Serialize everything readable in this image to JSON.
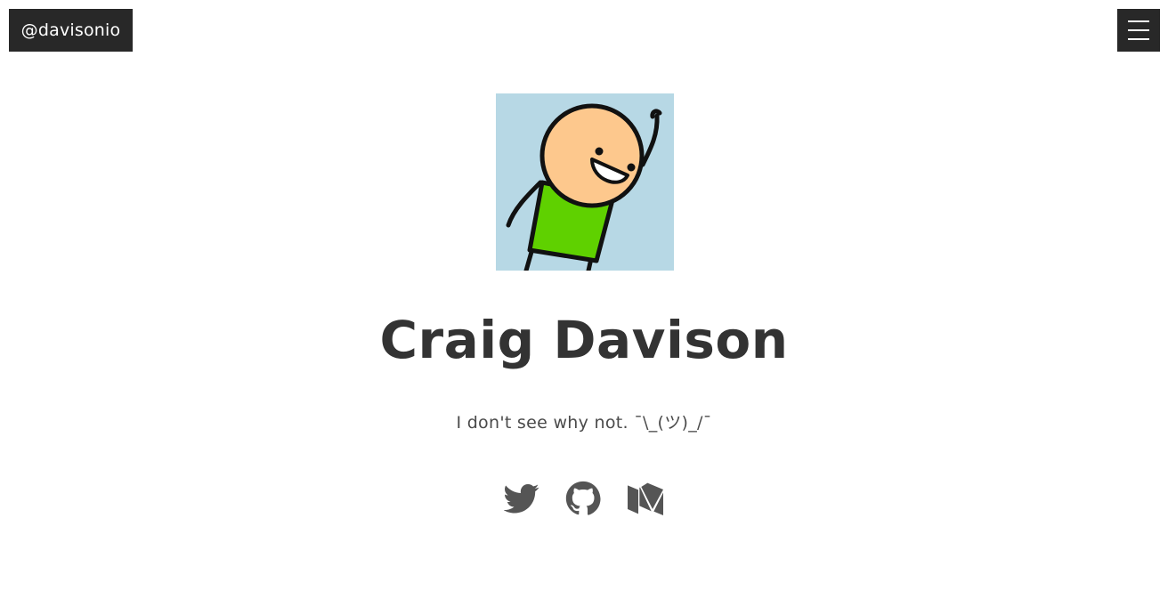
{
  "header": {
    "brand": "@davisonio",
    "menu_icon": "hamburger-menu-icon"
  },
  "profile": {
    "avatar_icon": "cartoon-avatar",
    "name": "Craig Davison",
    "tagline": "I don't see why not. ¯\\_(ツ)_/¯"
  },
  "social": [
    {
      "icon": "twitter-icon"
    },
    {
      "icon": "github-icon"
    },
    {
      "icon": "medium-icon"
    }
  ],
  "colors": {
    "dark_box": "#282828",
    "text": "#333333",
    "icon": "#555555",
    "avatar_bg": "#b7d8e5",
    "shirt": "#5fd100",
    "skin": "#fdc88d"
  }
}
